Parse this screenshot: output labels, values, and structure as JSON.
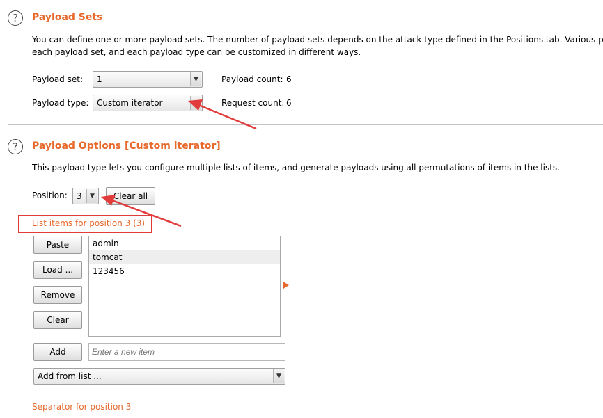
{
  "payload_sets": {
    "title": "Payload Sets",
    "description_line1": "You can define one or more payload sets. The number of payload sets depends on the attack type defined in the Positions tab. Various payloa",
    "description_line2": "each payload set, and each payload type can be customized in different ways.",
    "set_label": "Payload set:",
    "set_value": "1",
    "type_label": "Payload type:",
    "type_value": "Custom iterator",
    "payload_count_label": "Payload count:",
    "payload_count_value": "6",
    "request_count_label": "Request count:",
    "request_count_value": "6"
  },
  "payload_options": {
    "title": "Payload Options [Custom iterator]",
    "description": "This payload type lets you configure multiple lists of items, and generate payloads using all permutations of items in the lists.",
    "position_label": "Position:",
    "position_value": "3",
    "clear_all_label": "Clear all",
    "list_header": "List items for position 3 (3)",
    "buttons": {
      "paste": "Paste",
      "load": "Load ...",
      "remove": "Remove",
      "clear": "Clear",
      "add": "Add"
    },
    "items": [
      "admin",
      "tomcat",
      "123456"
    ],
    "new_item_placeholder": "Enter a new item",
    "add_from_list_value": "Add from list ...",
    "separator_label": "Separator for position 3"
  },
  "icons": {
    "help": "question-mark-icon",
    "dropdown": "chevron-down-icon",
    "expand": "triangle-right-icon"
  },
  "colors": {
    "accent": "#e8692c",
    "annotation": "#e23b3b"
  }
}
